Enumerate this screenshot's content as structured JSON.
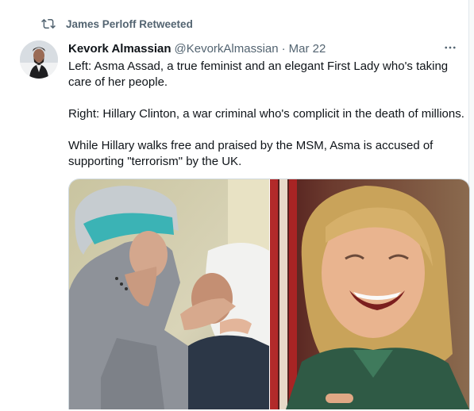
{
  "retweet": {
    "icon": "retweet-icon",
    "text": "James Perloff Retweeted"
  },
  "tweet": {
    "author_name": "Kevork Almassian",
    "author_handle": "@KevorkAlmassian",
    "separator": "·",
    "date": "Mar 22",
    "more_icon": "more-icon",
    "lines": [
      "Left: Asma Assad, a true feminist and an elegant First Lady who's taking care of her people.",
      "Right: Hillary Clinton, a war criminal who's complicit in the death of millions.",
      "While Hillary walks free and praised by the MSM, Asma is accused of supporting \"terrorism\" by the UK."
    ]
  },
  "colors": {
    "secondary_text": "#536471",
    "primary_text": "#0f1419",
    "border": "#cfd9de",
    "scarf_teal": "#3bb3b5"
  }
}
